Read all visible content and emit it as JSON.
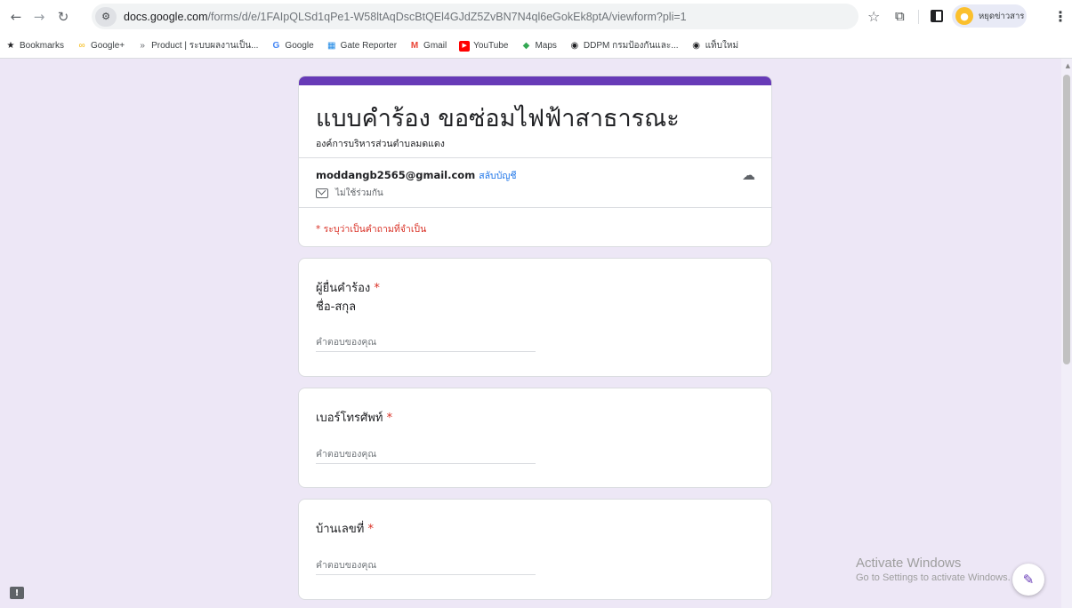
{
  "browser": {
    "url_host": "docs.google.com",
    "url_path": "/forms/d/e/1FAIpQLSd1qPe1-W58ltAqDscBtQEl4GJdZ5ZvBN7N4ql6eGokEk8ptA/viewform?pli=1",
    "profile_label": "หยุดข่าวสาร",
    "icons": {
      "back": "arrow-left",
      "forward": "arrow-right",
      "reload": "reload",
      "site_info": "tune",
      "star": "star",
      "extensions": "puzzle",
      "sidebar": "side-panel",
      "menu": "kebab"
    }
  },
  "bookmarks": [
    {
      "label": "Bookmarks",
      "icon": "star",
      "color": "#202124"
    },
    {
      "label": "Google+",
      "icon": "infinity",
      "color": "#f4b400"
    },
    {
      "label": "Product | ระบบผลงานเป็น...",
      "icon": "arrows",
      "color": "#5f6368"
    },
    {
      "label": "Google",
      "icon": "google-g",
      "color": "#4285f4"
    },
    {
      "label": "Gate Reporter",
      "icon": "grid",
      "color": "#1e88e5"
    },
    {
      "label": "Gmail",
      "icon": "gmail",
      "color": "#ea4335"
    },
    {
      "label": "YouTube",
      "icon": "youtube",
      "color": "#ff0000"
    },
    {
      "label": "Maps",
      "icon": "maps",
      "color": "#34a853"
    },
    {
      "label": "DDPM กรมป้องกันและ...",
      "icon": "globe",
      "color": "#202124"
    },
    {
      "label": "แท็บใหม่",
      "icon": "globe",
      "color": "#202124"
    }
  ],
  "form": {
    "title": "แบบคำร้อง ขอซ่อมไฟฟ้าสาธารณะ",
    "description": "องค์การบริหารส่วนตำบลมดแดง",
    "account_email": "moddangb2565@gmail.com",
    "switch_account": "สลับบัญชี",
    "not_shared": "ไม่ใช้ร่วมกัน",
    "required_note": "* ระบุว่าเป็นคำถามที่จำเป็น",
    "questions": [
      {
        "title": "ผู้ยื่นคำร้อง",
        "subtitle": "ชื่อ-สกุล",
        "placeholder": "คำตอบของคุณ",
        "required": "*"
      },
      {
        "title": "เบอร์โทรศัพท์",
        "placeholder": "คำตอบของคุณ",
        "required": "*"
      },
      {
        "title": "บ้านเลขที่",
        "placeholder": "คำตอบของคุณ",
        "required": "*"
      }
    ],
    "accent_color": "#673ab7",
    "background_color": "#ede7f6",
    "required_color": "#d93025"
  },
  "watermark": {
    "line1": "Activate Windows",
    "line2": "Go to Settings to activate Windows."
  }
}
